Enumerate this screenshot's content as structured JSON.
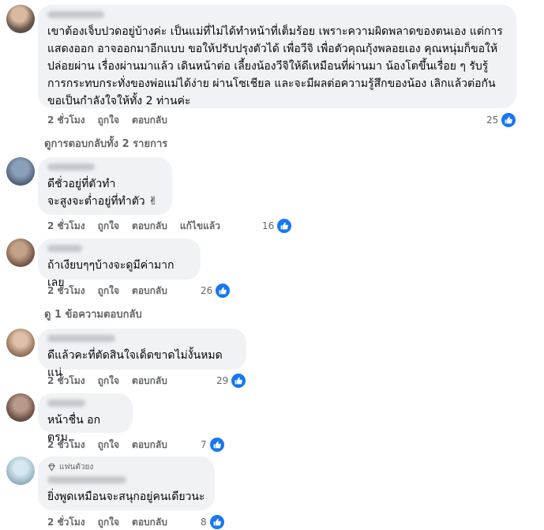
{
  "comments": [
    {
      "text": "เขาต้องเจ็บปวดอยู่บ้างค่ะ เป็นแม่ที่ไม่ได้ทำหน้าที่เต็มร้อย เพราะความผิดพลาดของตนเอง แต่การแสดงออก อาจออกมาอีกแบบ ขอให้ปรับปรุงตัวได้ เพื่อวีจิ เพื่อตัวคุณกุ้งพลอยเอง คุณหนุ่มก็ขอให้ปล่อยผ่าน เรื่องผ่านมาแล้ว เดินหน้าต่อ เลี้ยงน้องวีจิให้ดีเหมือนที่ผ่านมา น้องโตขึ้นเรื่อย ๆ รับรู้การกระทบกระทั่งของพ่อแม่ได้ง่าย ผ่านโซเชียล และจะมีผลต่อความรู้สึกของน้อง เลิกแล้วต่อกัน ขอเป็นกำลังใจให้ทั้ง 2 ท่านค่ะ",
      "time": "2 ชั่วโมง",
      "like": "ถูกใจ",
      "reply": "ตอบกลับ",
      "count": "25"
    },
    {
      "text": "ดีชั่วอยู่ที่ตัวทำ จะสูงจะต่ำอยู่ที่ทำตัว ✌",
      "time": "2 ชั่วโมง",
      "like": "ถูกใจ",
      "reply": "ตอบกลับ",
      "edited": "แก้ไขแล้ว",
      "count": "16"
    },
    {
      "text": "ถ้าเงียบๆๆบ้างจะดูมีค่ามากเลย",
      "time": "2 ชั่วโมง",
      "like": "ถูกใจ",
      "reply": "ตอบกลับ",
      "count": "26"
    },
    {
      "text": "ดีแล้วคะที่ตัดสินใจเด็ดขาดไม่งั้นหมดแน่",
      "time": "2 ชั่วโมง",
      "like": "ถูกใจ",
      "reply": "ตอบกลับ",
      "count": "29"
    },
    {
      "text": "หน้าชื่น อกตรม..",
      "time": "2 ชั่วโมง",
      "like": "ถูกใจ",
      "reply": "ตอบกลับ",
      "count": "7"
    },
    {
      "badge": "แฟนตัวยง",
      "text": "ยิ่งพูดเหมือนจะสนุกอยู่คนเดียวนะ",
      "time": "2 ชั่วโมง",
      "like": "ถูกใจ",
      "reply": "ตอบกลับ",
      "count": "8"
    }
  ],
  "view_replies_1": "ดูการตอบกลับทั้ง 2 รายการ",
  "view_replies_2": "ดู 1 ข้อความตอบกลับ",
  "colors": {
    "like_blue": "#1877f2",
    "bubble": "#f0f2f5",
    "meta": "#65676b"
  }
}
